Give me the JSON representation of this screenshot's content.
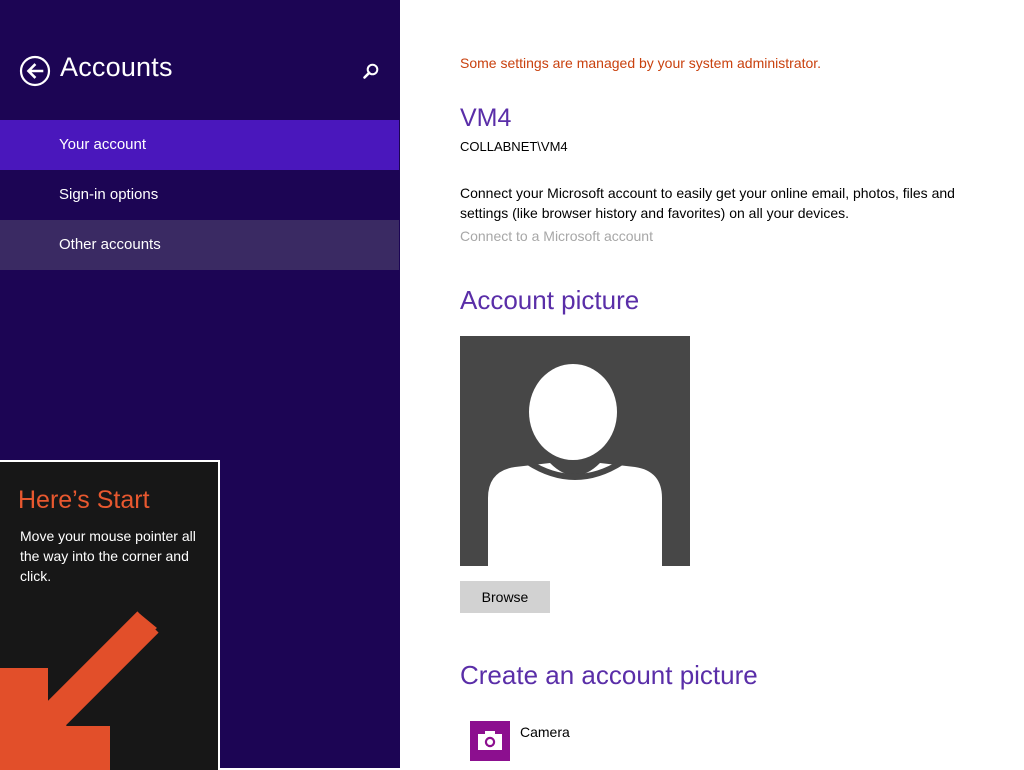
{
  "nav": {
    "title": "Accounts",
    "items": [
      {
        "label": "Your account",
        "state": "selected"
      },
      {
        "label": "Sign-in options",
        "state": "normal"
      },
      {
        "label": "Other accounts",
        "state": "hover"
      }
    ],
    "icons": {
      "back": "back-arrow-circle-icon",
      "search": "search-icon"
    }
  },
  "tip": {
    "title": "Here’s Start",
    "body": "Move your mouse pointer all the way into the corner and click.",
    "icon": "arrow-down-left-icon"
  },
  "main": {
    "admin_message": "Some settings are managed by your system administrator.",
    "account_name": "VM4",
    "account_domain": "COLLABNET\\VM4",
    "connect_description": "Connect your Microsoft account to easily get your online email, photos, files and settings (like browser history and favorites) on all your devices.",
    "connect_link": "Connect to a Microsoft account",
    "picture_heading": "Account picture",
    "browse_label": "Browse",
    "create_heading": "Create an account picture",
    "camera_label": "Camera"
  },
  "colors": {
    "nav_background": "#1c0554",
    "nav_selected": "#4a17bc",
    "nav_hover": "#3a2a63",
    "accent_heading": "#5a2ea8",
    "admin_warning": "#c9410e",
    "tip_title": "#e8582f",
    "camera_tile": "#8c0f8f"
  }
}
